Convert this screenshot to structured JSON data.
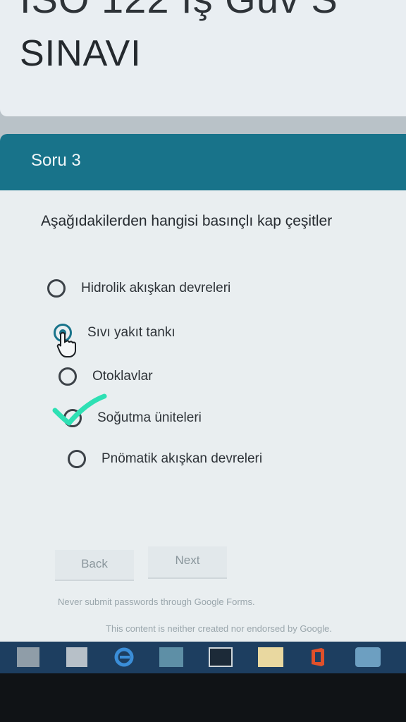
{
  "header": {
    "partial_line": "ISO 122 İş Güv S",
    "title": "SINAVI"
  },
  "section": {
    "label": "Soru 3",
    "question": "Aşağıdakilerden hangisi basınçlı kap çeşitler",
    "options": [
      {
        "label": "Hidrolik akışkan devreleri",
        "selected": false
      },
      {
        "label": "Sıvı yakıt tankı",
        "selected": true
      },
      {
        "label": "Otoklavlar",
        "selected": false
      },
      {
        "label": "Soğutma üniteleri",
        "selected": false
      },
      {
        "label": "Pnömatik akışkan devreleri",
        "selected": false
      }
    ]
  },
  "nav": {
    "back_label": "Back",
    "next_label": "Next"
  },
  "footer": {
    "password_warning": "Never submit passwords through Google Forms.",
    "disclaimer": "This content is neither created nor endorsed by Google."
  },
  "taskbar": {
    "icons": [
      "file-explorer-icon",
      "app-icon",
      "internet-explorer-icon",
      "app-icon",
      "window-icon",
      "app-icon",
      "office-icon",
      "app-icon"
    ]
  },
  "colors": {
    "accent": "#18738a",
    "check_mark": "#2ee0b4",
    "taskbar": "#1d3e60"
  }
}
